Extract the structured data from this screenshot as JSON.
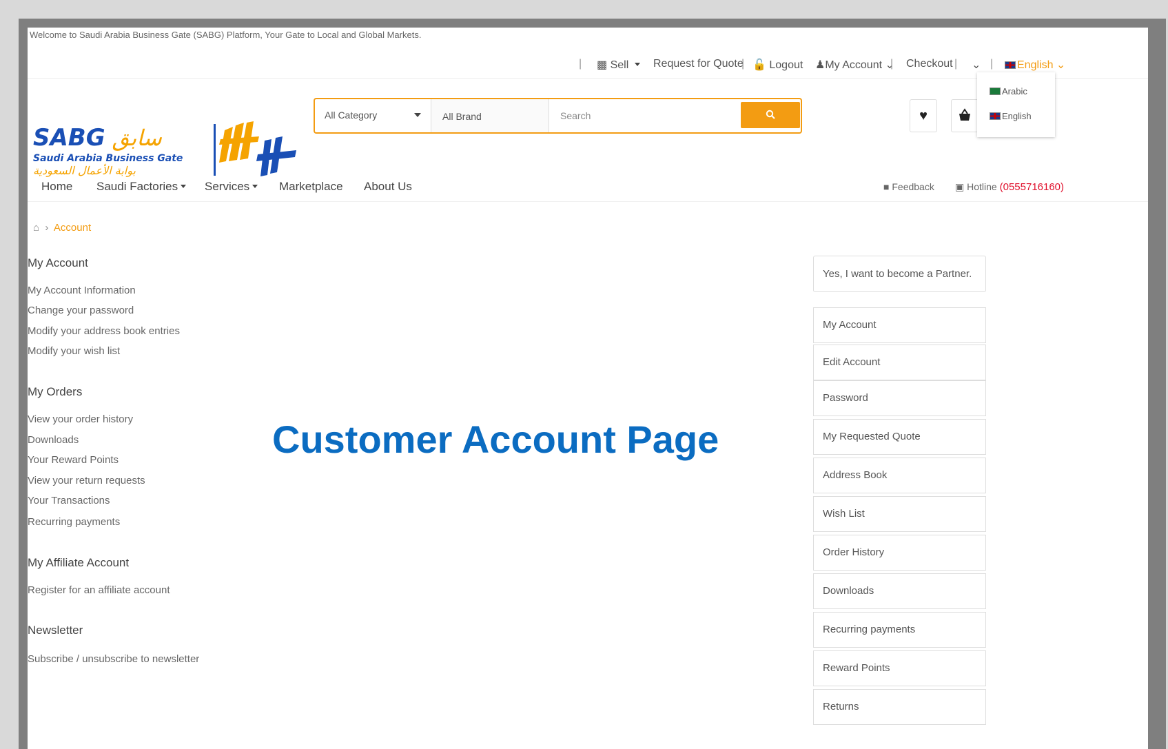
{
  "welcome": "Welcome to Saudi Arabia Business Gate (SABG) Platform, Your Gate to Local and Global Markets.",
  "topbar": {
    "sell": "Sell",
    "request_quote": "Request for Quote",
    "logout": "Logout",
    "my_account": "My Account",
    "checkout": "Checkout",
    "language": "English"
  },
  "logo": {
    "sabg": "SABG",
    "arabic_top": "سابق",
    "subtitle": "Saudi Arabia Business Gate",
    "subtitle_ar": "بوابة الأعمال السعودية"
  },
  "search": {
    "category": "All Category",
    "brand": "All Brand",
    "placeholder": "Search"
  },
  "language_dropdown": [
    "Arabic",
    "English"
  ],
  "nav": {
    "home": "Home",
    "saudi_factories": "Saudi Factories",
    "services": "Services",
    "marketplace": "Marketplace",
    "about": "About Us",
    "feedback": "Feedback",
    "hotline_label": "Hotline",
    "hotline_number": "(0555716160)"
  },
  "breadcrumb": {
    "current": "Account"
  },
  "sidebar": {
    "my_account": {
      "title": "My Account",
      "links": [
        "My Account Information",
        "Change your password",
        "Modify your address book entries",
        "Modify your wish list"
      ]
    },
    "my_orders": {
      "title": "My Orders",
      "links": [
        "View your order history",
        "Downloads",
        "Your Reward Points",
        "View your return requests",
        "Your Transactions",
        "Recurring payments"
      ]
    },
    "affiliate": {
      "title": "My Affiliate Account",
      "links": [
        "Register for an affiliate account"
      ]
    },
    "newsletter": {
      "title": "Newsletter",
      "links": [
        "Subscribe / unsubscribe to newsletter"
      ]
    }
  },
  "heading": "Customer Account Page",
  "right_panel": {
    "partner": "Yes, I want to become a Partner.",
    "items": [
      "My Account",
      "Edit Account",
      "Password",
      "My Requested Quote",
      "Address Book",
      "Wish List",
      "Order History",
      "Downloads",
      "Recurring payments",
      "Reward Points",
      "Returns"
    ]
  },
  "colors": {
    "accent": "#f39c12",
    "heading": "#0b6cc1",
    "hotline": "#e0102c"
  }
}
